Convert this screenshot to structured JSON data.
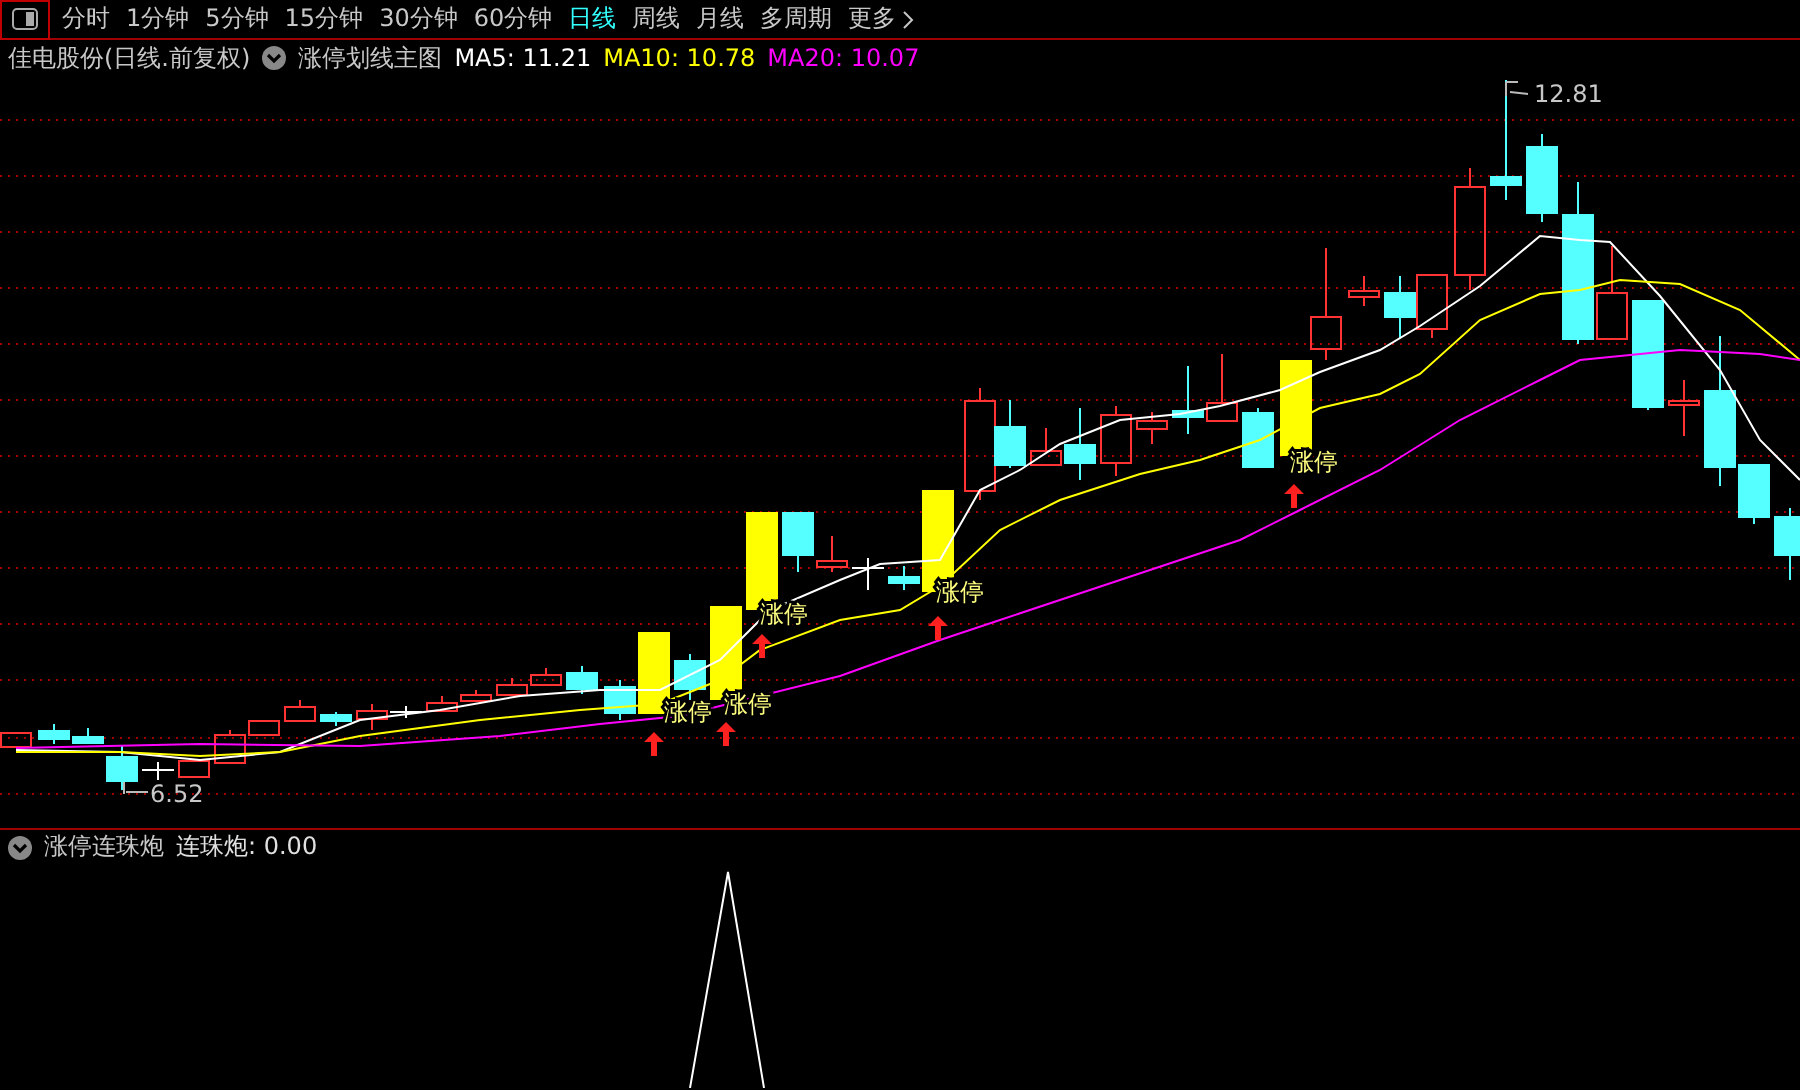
{
  "toolbar": {
    "tabs": [
      {
        "label": "分时",
        "selected": false
      },
      {
        "label": "1分钟",
        "selected": false
      },
      {
        "label": "5分钟",
        "selected": false
      },
      {
        "label": "15分钟",
        "selected": false
      },
      {
        "label": "30分钟",
        "selected": false
      },
      {
        "label": "60分钟",
        "selected": false
      },
      {
        "label": "日线",
        "selected": true
      },
      {
        "label": "周线",
        "selected": false
      },
      {
        "label": "月线",
        "selected": false
      },
      {
        "label": "多周期",
        "selected": false
      },
      {
        "label": "更多",
        "selected": false
      }
    ]
  },
  "info_bar": {
    "security": "佳电股份(日线.前复权)",
    "template": "涨停划线主图",
    "ma": [
      {
        "label": "MA5: 11.21",
        "color": "#ffffff"
      },
      {
        "label": "MA10: 10.78",
        "color": "#ffff00"
      },
      {
        "label": "MA20: 10.07",
        "color": "#ff00ff"
      }
    ]
  },
  "main_chart": {
    "high_label": "12.81",
    "low_label": "6.52",
    "signals": [
      {
        "label": "涨停"
      },
      {
        "label": "涨停"
      },
      {
        "label": "涨停"
      },
      {
        "label": "涨停"
      },
      {
        "label": "涨停"
      }
    ]
  },
  "indicator": {
    "name": "涨停连珠炮",
    "reading": "连珠炮: 0.00"
  }
}
